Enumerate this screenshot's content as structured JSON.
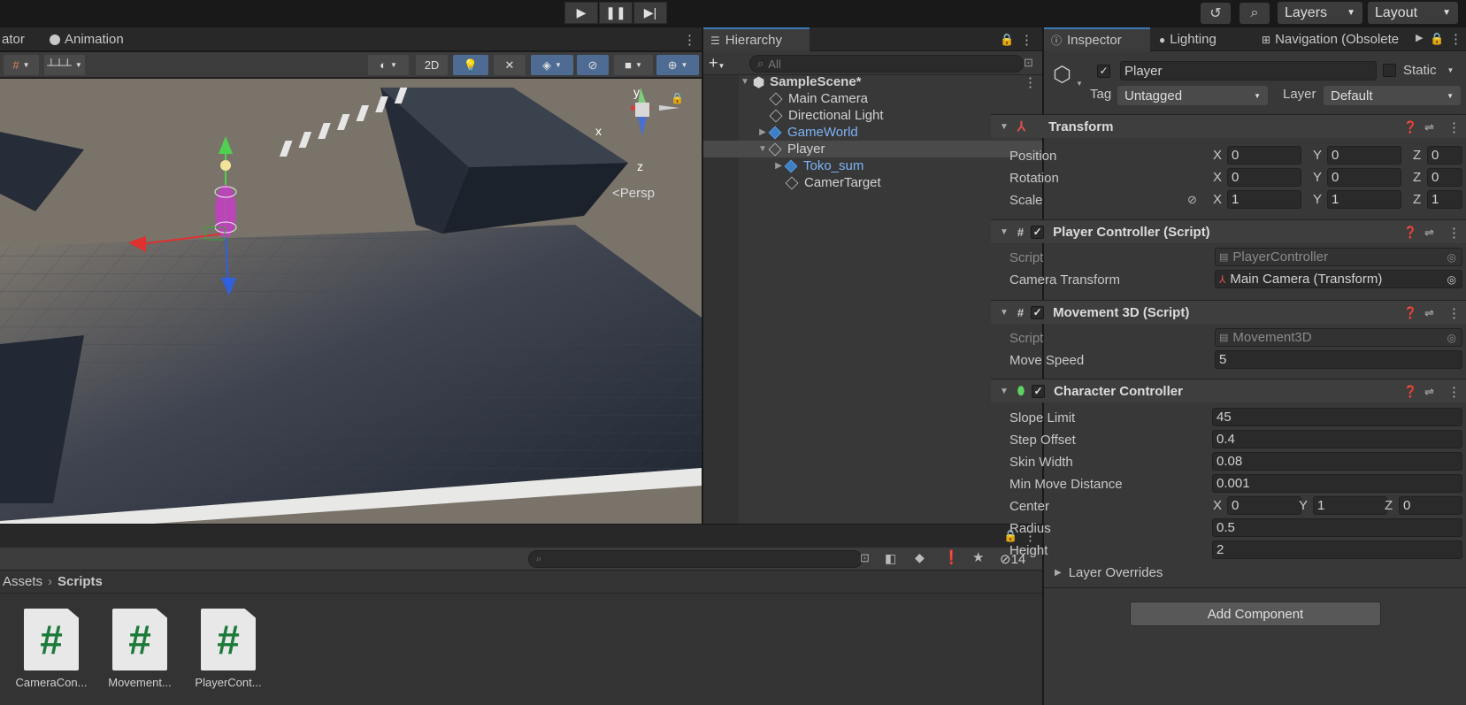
{
  "topbar": {
    "play_icon": "play-icon",
    "pause_icon": "pause-icon",
    "step_icon": "step-icon",
    "history_icon": "history-icon",
    "search_icon": "search-icon",
    "layers_label": "Layers",
    "layout_label": "Layout"
  },
  "scene_panel": {
    "tabs": [
      "ator",
      "Animation"
    ],
    "toolbar": {
      "mode_2d": "2D"
    },
    "gizmo": {
      "x": "x",
      "y": "y",
      "z": "z",
      "persp": "Persp"
    }
  },
  "hierarchy": {
    "tab": "Hierarchy",
    "search_placeholder": "All",
    "scene": "SampleScene*",
    "items": [
      {
        "label": "Main Camera",
        "prefab": false
      },
      {
        "label": "Directional Light",
        "prefab": false
      },
      {
        "label": "GameWorld",
        "prefab": true
      },
      {
        "label": "Player",
        "prefab": false
      },
      {
        "label": "Toko_sum",
        "prefab": true
      },
      {
        "label": "CamerTarget",
        "prefab": false
      }
    ]
  },
  "inspector": {
    "tabs": [
      "Inspector",
      "Lighting",
      "Navigation (Obsolete"
    ],
    "object_name": "Player",
    "static_label": "Static",
    "tag_label": "Tag",
    "tag_value": "Untagged",
    "layer_label": "Layer",
    "layer_value": "Default",
    "transform": {
      "title": "Transform",
      "position_label": "Position",
      "rotation_label": "Rotation",
      "scale_label": "Scale",
      "position": [
        "0",
        "0",
        "0"
      ],
      "rotation": [
        "0",
        "0",
        "0"
      ],
      "scale": [
        "1",
        "1",
        "1"
      ]
    },
    "player_controller": {
      "title": "Player Controller (Script)",
      "script_label": "Script",
      "script_value": "PlayerController",
      "camera_label": "Camera Transform",
      "camera_value": "Main Camera (Transform)"
    },
    "movement": {
      "title": "Movement 3D (Script)",
      "script_label": "Script",
      "script_value": "Movement3D",
      "speed_label": "Move Speed",
      "speed_value": "5"
    },
    "character_controller": {
      "title": "Character Controller",
      "slope_label": "Slope Limit",
      "slope": "45",
      "step_label": "Step Offset",
      "step": "0.4",
      "skin_label": "Skin Width",
      "skin": "0.08",
      "min_move_label": "Min Move Distance",
      "min_move": "0.001",
      "center_label": "Center",
      "center": [
        "0",
        "1",
        "0"
      ],
      "radius_label": "Radius",
      "radius": "0.5",
      "height_label": "Height",
      "height": "2",
      "overrides_label": "Layer Overrides"
    },
    "add_component": "Add Component",
    "axes": {
      "x": "X",
      "y": "Y",
      "z": "Z"
    }
  },
  "project": {
    "breadcrumb_root": "Assets",
    "breadcrumb_current": "Scripts",
    "hidden_count": "14",
    "assets": [
      "CameraCon...",
      "Movement...",
      "PlayerCont..."
    ],
    "asset_glyph": "#"
  }
}
